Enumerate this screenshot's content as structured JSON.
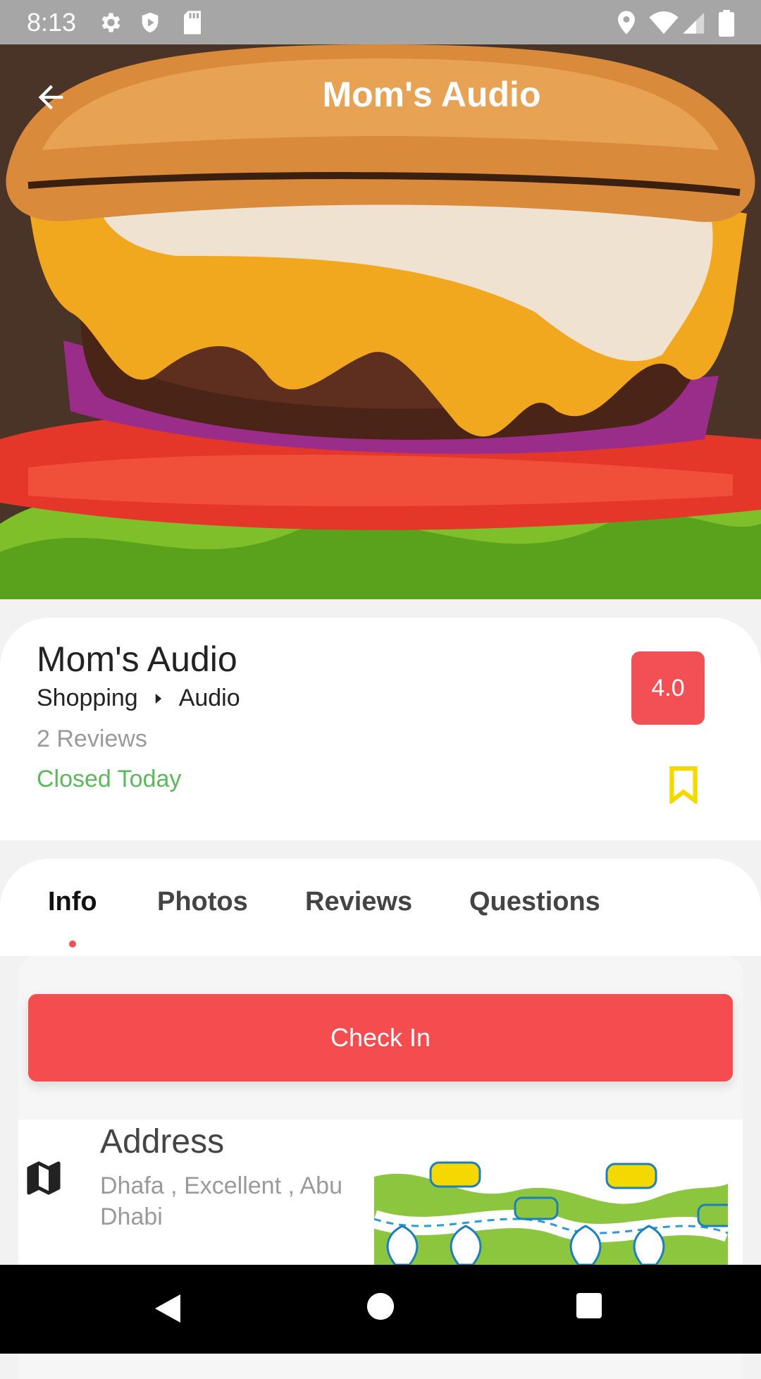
{
  "status_bar": {
    "time": "8:13",
    "left_icons": [
      "gear-icon",
      "shield-icon",
      "sd-card-icon"
    ],
    "right_icons": [
      "location-icon",
      "wifi-icon",
      "signal-icon",
      "battery-icon"
    ]
  },
  "header": {
    "title": "Mom's Audio",
    "back_icon": "arrow-left-icon"
  },
  "place": {
    "name": "Mom's Audio",
    "category": "Shopping",
    "subcategory": "Audio",
    "reviews_count": "2 Reviews",
    "status": "Closed Today",
    "status_color": "#5cb85c",
    "rating": "4.0",
    "rating_color": "#f25055",
    "bookmark_color": "#f5d800"
  },
  "tabs": [
    {
      "label": "Info",
      "active": true
    },
    {
      "label": "Photos",
      "active": false
    },
    {
      "label": "Reviews",
      "active": false
    },
    {
      "label": "Questions",
      "active": false
    }
  ],
  "checkin": {
    "label": "Check In",
    "color": "#f44c4f"
  },
  "address": {
    "title": "Address",
    "text": "Dhafa , Excellent , Abu Dhabi",
    "icon": "map-icon"
  },
  "nav_bar": [
    "back-triangle-icon",
    "home-circle-icon",
    "recents-square-icon"
  ]
}
